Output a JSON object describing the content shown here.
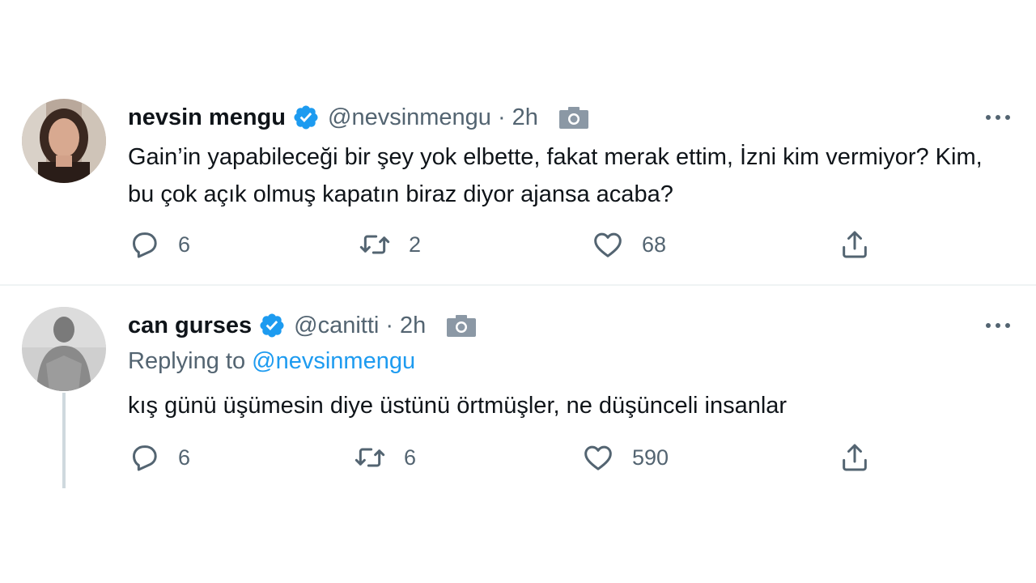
{
  "tweets": [
    {
      "name": "nevsin mengu",
      "handle": "@nevsinmengu",
      "dot": "·",
      "time": "2h",
      "text": "Gain’in yapabileceği bir şey yok elbette, fakat merak ettim, İzni kim vermiyor? Kim, bu çok açık olmuş kapatın biraz diyor ajansa acaba?",
      "replies": "6",
      "retweets": "2",
      "likes": "68"
    },
    {
      "name": "can gurses",
      "handle": "@canitti",
      "dot": "·",
      "time": "2h",
      "replying_prefix": "Replying to",
      "replying_to": "@nevsinmengu",
      "text": "kış günü üşümesin diye üstünü örtmüşler, ne düşünceli insanlar",
      "replies": "6",
      "retweets": "6",
      "likes": "590"
    }
  ],
  "icons": {
    "verified": "verified-badge-icon",
    "camera": "camera-icon",
    "more": "more-horizontal-icon",
    "reply": "reply-icon",
    "retweet": "retweet-icon",
    "like": "heart-icon",
    "share": "share-icon"
  },
  "colors": {
    "accent": "#1d9bf0",
    "secondary_text": "#536471",
    "primary_text": "#0f1419",
    "divider": "#eff3f4"
  }
}
